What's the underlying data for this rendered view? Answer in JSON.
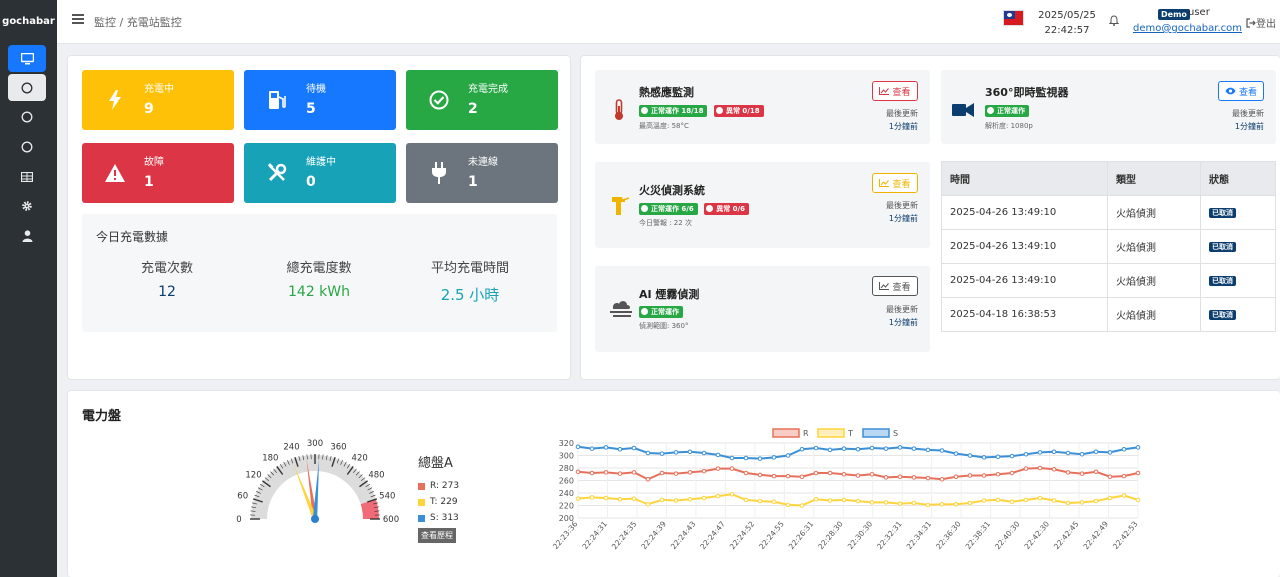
{
  "brand": "gochabar",
  "breadcrumb": "監控 / 充電站監控",
  "header": {
    "date": "2025/05/25",
    "time": "22:42:57",
    "user_badge": "Demo",
    "user_name": "user",
    "user_email": "demo@gochabar.com",
    "logout": "登出"
  },
  "status_tiles": [
    {
      "label": "充電中",
      "value": "9",
      "color": "#ffc107",
      "icon": "bolt-icon"
    },
    {
      "label": "待機",
      "value": "5",
      "color": "#1677ff",
      "icon": "gas-pump-icon"
    },
    {
      "label": "充電完成",
      "value": "2",
      "color": "#28a745",
      "icon": "check-circle-icon"
    },
    {
      "label": "故障",
      "value": "1",
      "color": "#dc3545",
      "icon": "warning-icon"
    },
    {
      "label": "維護中",
      "value": "0",
      "color": "#17a2b8",
      "icon": "tools-icon"
    },
    {
      "label": "未連線",
      "value": "1",
      "color": "#6c757d",
      "icon": "plug-icon"
    }
  ],
  "today": {
    "title": "今日充電數據",
    "stats": [
      {
        "label": "充電次數",
        "value": "12",
        "color": "#0b3d6e"
      },
      {
        "label": "總充電度數",
        "value": "142 kWh",
        "color": "#28a745"
      },
      {
        "label": "平均充電時間",
        "value": "2.5 小時",
        "color": "#17a2b8"
      }
    ]
  },
  "monitors": {
    "thermal": {
      "title": "熱感應監測",
      "ok": "正常運作 18/18",
      "err": "異常 0/18",
      "sub": "最高溫度: 58°C",
      "view": "查看",
      "upd": "最後更新",
      "ago": "1分鐘前"
    },
    "camera": {
      "title": "360°即時監視器",
      "ok": "正常運作",
      "sub": "解析度: 1080p",
      "view": "查看",
      "upd": "最後更新",
      "ago": "1分鐘前"
    },
    "fire": {
      "title": "火災偵測系統",
      "ok": "正常運作 6/6",
      "err": "異常 0/6",
      "sub": "今日警報 : 22 次",
      "view": "查看",
      "upd": "最後更新",
      "ago": "1分鐘前"
    },
    "smoke": {
      "title": "AI 煙霧偵測",
      "ok": "正常運作",
      "sub": "偵測範圍: 360°",
      "view": "查看",
      "upd": "最後更新",
      "ago": "1分鐘前"
    }
  },
  "events": {
    "headers": [
      "時間",
      "類型",
      "狀態"
    ],
    "rows": [
      {
        "time": "2025-04-26 13:49:10",
        "type": "火焰偵測",
        "status": "已取消"
      },
      {
        "time": "2025-04-26 13:49:10",
        "type": "火焰偵測",
        "status": "已取消"
      },
      {
        "time": "2025-04-26 13:49:10",
        "type": "火焰偵測",
        "status": "已取消"
      },
      {
        "time": "2025-04-18 16:38:53",
        "type": "火焰偵測",
        "status": "已取消"
      }
    ]
  },
  "power": {
    "title": "電力盤",
    "gauge": {
      "ticks": [
        "0",
        "60",
        "120",
        "180",
        "240",
        "300",
        "360",
        "420",
        "480",
        "540",
        "600"
      ],
      "min": 0,
      "max": 600,
      "redzone_from": 540,
      "legend_title": "總盤A",
      "readings": [
        {
          "label": "R: 273",
          "value": 273,
          "color": "#e8705a"
        },
        {
          "label": "T: 229",
          "value": 229,
          "color": "#ffd43b"
        },
        {
          "label": "S: 313",
          "value": 313,
          "color": "#3a8fd9"
        }
      ],
      "history_button": "查看歷程"
    }
  },
  "chart_data": {
    "type": "line",
    "legend": [
      "R",
      "T",
      "S"
    ],
    "ylim": [
      200,
      320
    ],
    "yticks": [
      "320",
      "300",
      "280",
      "260",
      "240",
      "220",
      "200"
    ],
    "xtick_labels": [
      "22:23:36",
      "22:24:31",
      "22:24:35",
      "22:24:39",
      "22:24:43",
      "22:24:47",
      "22:24:52",
      "22:24:55",
      "22:26:31",
      "22:28:30",
      "22:30:30",
      "22:32:31",
      "22:34:31",
      "22:36:30",
      "22:38:31",
      "22:40:30",
      "22:42:30",
      "22:42:45",
      "22:42:49",
      "22:42:53"
    ],
    "series": [
      {
        "name": "R",
        "color": "#e8705a",
        "values": [
          274,
          272,
          273,
          271,
          273,
          262,
          272,
          271,
          273,
          275,
          279,
          279,
          272,
          269,
          267,
          267,
          266,
          272,
          272,
          270,
          268,
          270,
          265,
          266,
          265,
          264,
          262,
          266,
          268,
          268,
          270,
          272,
          279,
          280,
          278,
          273,
          271,
          274,
          266,
          267,
          272
        ]
      },
      {
        "name": "T",
        "color": "#ffd43b",
        "values": [
          231,
          233,
          232,
          230,
          231,
          222,
          229,
          228,
          230,
          232,
          235,
          238,
          229,
          227,
          226,
          221,
          220,
          230,
          228,
          229,
          227,
          225,
          225,
          223,
          224,
          221,
          222,
          222,
          224,
          228,
          229,
          226,
          229,
          232,
          228,
          224,
          225,
          227,
          232,
          236,
          229
        ]
      },
      {
        "name": "S",
        "color": "#3a8fd9",
        "values": [
          314,
          311,
          313,
          310,
          312,
          304,
          303,
          305,
          306,
          304,
          301,
          296,
          296,
          295,
          297,
          300,
          310,
          312,
          309,
          311,
          310,
          312,
          311,
          313,
          311,
          309,
          308,
          303,
          300,
          297,
          298,
          299,
          302,
          305,
          306,
          304,
          302,
          306,
          305,
          310,
          313
        ]
      }
    ]
  },
  "colors": {
    "sidebar": "#2c3136",
    "accent": "#1677ff",
    "navy": "#0b3d6e",
    "success": "#28a745",
    "danger": "#dc3545",
    "warning": "#ffc107"
  }
}
